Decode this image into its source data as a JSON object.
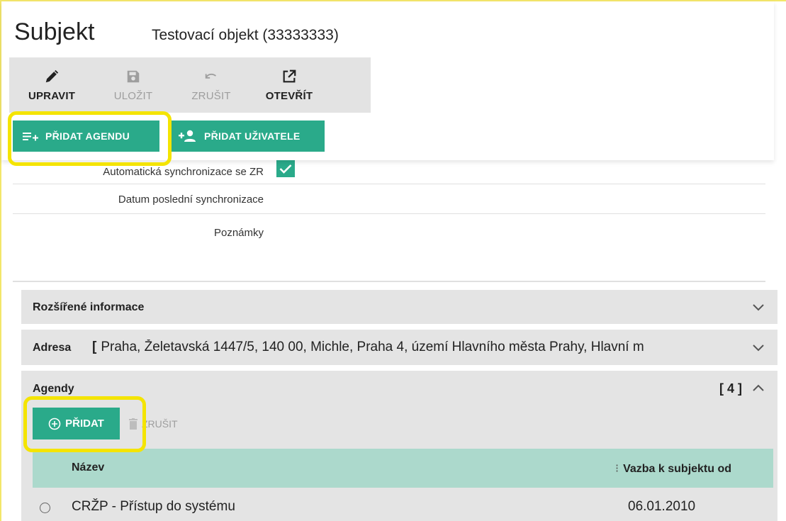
{
  "header": {
    "title": "Subjekt",
    "subtitle": "Testovací objekt (33333333)"
  },
  "toolbar": {
    "edit_label": "UPRAVIT",
    "save_label": "ULOŽIT",
    "cancel_label": "ZRUŠIT",
    "open_label": "OTEVŘÍT",
    "add_agenda_label": "PŘIDAT AGENDU",
    "add_user_label": "PŘIDAT UŽIVATELE"
  },
  "form": {
    "sync_label": "Automatická synchronizace se ZR",
    "sync_checked": true,
    "last_sync_label": "Datum poslední synchronizace",
    "notes_label": "Poznámky"
  },
  "sections": {
    "extended_info_title": "Rozšířené informace",
    "address_title": "Adresa",
    "address_bracket": "[",
    "address_value": "Praha, Želetavská 1447/5, 140 00, Michle, Praha 4, území Hlavního města Prahy, Hlavní m",
    "agendas_title": "Agendy",
    "agendas_count": "[ 4 ]",
    "add_label": "PŘIDAT",
    "cancel_label": "ZRUŠIT"
  },
  "table": {
    "columns": [
      "Název",
      "Vazba k subjektu od"
    ],
    "rows": [
      {
        "name": "CRŽP - Přístup do systému",
        "date": "06.01.2010"
      }
    ]
  },
  "colors": {
    "accent": "#2aaa8a",
    "highlight": "#f4e400",
    "table_header": "#acd9cc",
    "section_bg": "#e4e4e4"
  },
  "icons": [
    "pencil-icon",
    "save-icon",
    "undo-icon",
    "open-external-icon",
    "add-list-icon",
    "add-user-icon",
    "check-icon",
    "chevron-down-icon",
    "chevron-up-icon",
    "plus-circle-icon",
    "trash-icon",
    "radio-icon"
  ]
}
